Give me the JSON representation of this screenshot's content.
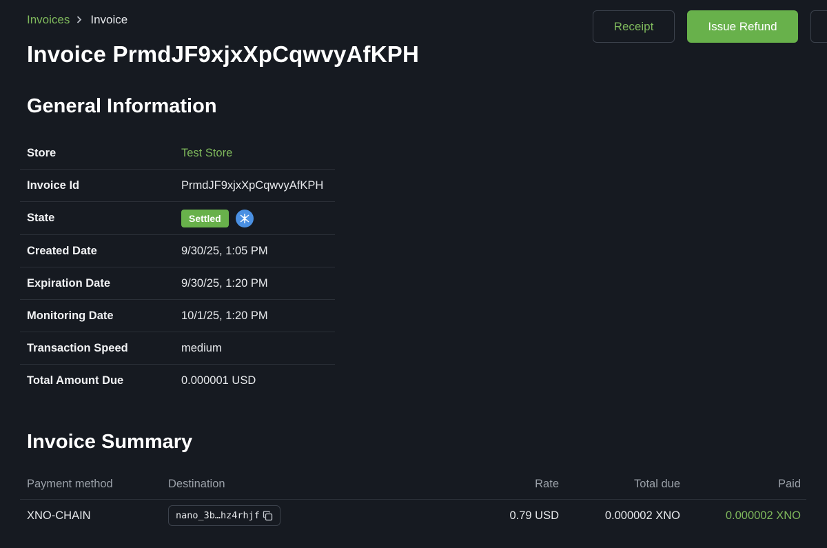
{
  "breadcrumb": {
    "parent": "Invoices",
    "separator": "›",
    "current": "Invoice"
  },
  "actions": {
    "receipt_label": "Receipt",
    "refund_label": "Issue Refund"
  },
  "title": "Invoice PrmdJF9xjxXpCqwvyAfKPH",
  "general": {
    "heading": "General Information",
    "rows": [
      {
        "label": "Store",
        "value": "Test Store"
      },
      {
        "label": "Invoice Id",
        "value": "PrmdJF9xjxXpCqwvyAfKPH"
      },
      {
        "label": "State",
        "value": "Settled"
      },
      {
        "label": "Created Date",
        "value": "9/30/25, 1:05 PM"
      },
      {
        "label": "Expiration Date",
        "value": "9/30/25, 1:20 PM"
      },
      {
        "label": "Monitoring Date",
        "value": "10/1/25, 1:20 PM"
      },
      {
        "label": "Transaction Speed",
        "value": "medium"
      },
      {
        "label": "Total Amount Due",
        "value": "0.000001 USD"
      }
    ],
    "state_icon": "nano-icon"
  },
  "summary": {
    "heading": "Invoice Summary",
    "columns": {
      "method": "Payment method",
      "destination": "Destination",
      "rate": "Rate",
      "total_due": "Total due",
      "paid": "Paid"
    },
    "rows": [
      {
        "method": "XNO-CHAIN",
        "destination": "nano_3b…hz4rhjf",
        "rate": "0.79 USD",
        "total_due": "0.000002 XNO",
        "paid": "0.000002 XNO"
      }
    ]
  },
  "colors": {
    "background": "#161a21",
    "accent": "#68b14b",
    "link": "#7fb95c",
    "border": "#3c424c"
  }
}
